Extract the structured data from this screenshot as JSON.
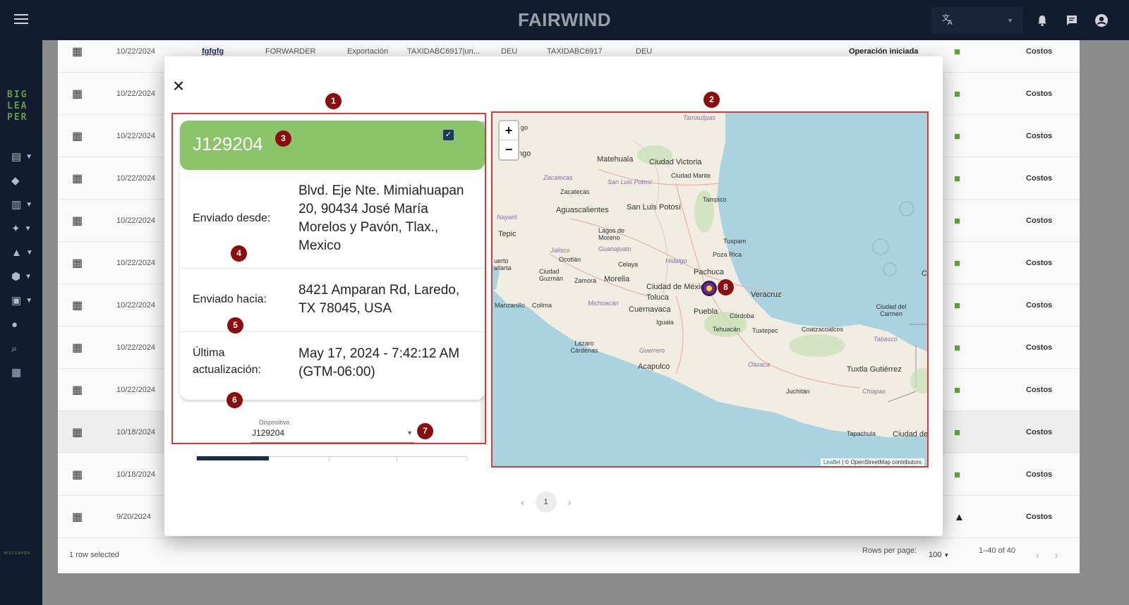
{
  "app": {
    "brand": "FAIRWIND",
    "logo_text": "BIG LEA PER",
    "sidebar_footer": "BIGLEAPER"
  },
  "topbar": {
    "menu_icon": "menu-icon",
    "translate_icon": "translate-icon",
    "notifications_icon": "bell-icon",
    "chat_icon": "chat-icon",
    "account_icon": "account-icon"
  },
  "table": {
    "first_row": {
      "date": "10/22/2024",
      "id": "fgfgfg",
      "role": "FORWARDER",
      "type": "Exportación",
      "taxid": "TAXIDABC6917|un...",
      "country": "DEU",
      "taxid2": "TAXIDABC6917",
      "country2": "DEU",
      "status": "Operación iniciada",
      "action": "Costos"
    },
    "dates": [
      "10/22/2024",
      "10/22/2024",
      "10/22/2024",
      "10/22/2024",
      "10/22/2024",
      "10/22/2024",
      "10/22/2024",
      "10/22/2024",
      "10/22/2024",
      "10/18/2024",
      "10/18/2024",
      "9/20/2024"
    ],
    "action_label": "Costos",
    "footer": {
      "selected": "1 row selected",
      "rows_per_page_label": "Rows per page:",
      "rows_per_page": "100",
      "range": "1–40 of 40"
    }
  },
  "modal": {
    "device_id": "J129204",
    "sent_from_label": "Enviado desde:",
    "sent_from_value": "Blvd. Eje Nte. Mimiahuapan 20, 90434 José María Morelos y Pavón, Tlax., Mexico",
    "sent_to_label": "Enviado hacia:",
    "sent_to_value": "8421 Amparan Rd, Laredo, TX 78045, USA",
    "updated_label": "Última actualización:",
    "updated_value": "May 17, 2024 - 7:42:12 AM (GTM-06:00)",
    "device_select_label": "Dispositivo",
    "device_select_value": "J129204",
    "pagination_current": "1"
  },
  "map": {
    "zoom_in": "+",
    "zoom_out": "−",
    "attribution_leaflet": "Leaflet",
    "attribution_osm": "© OpenStreetMap contributors",
    "places": {
      "tamaulipas": "Tamaulipas",
      "matehuala": "Matehuala",
      "ciudad_victoria": "Ciudad Victoria",
      "ciudad_mante": "Ciudad Mante",
      "zacatecas_state": "Zacatecas",
      "zacatecas": "Zacatecas",
      "slp_state": "San Luis Potosí",
      "slp": "San Luis Potosí",
      "aguascalientes": "Aguascalientes",
      "tampico": "Tampico",
      "nayarit": "Nayarit",
      "tepic": "Tepic",
      "lagos": "Lagos de Moreno",
      "guanajuato": "Guanajuato",
      "tuxpam": "Tuxpam",
      "poza_rica": "Poza Rica",
      "jalisco": "Jalisco",
      "ocotlan": "Ocotlán",
      "celaya": "Celaya",
      "hidalgo": "Hidalgo",
      "pachuca": "Pachuca",
      "ciudad_guzman": "Ciudad Guzmán",
      "zamora": "Zamora",
      "morelia": "Morelia",
      "ciudad_mexico": "Ciudad de México",
      "veracruz": "Veracruz",
      "colima": "Colima",
      "michoacan": "Michoacán",
      "toluca": "Toluca",
      "cuernavaca": "Cuernavaca",
      "puebla": "Puebla",
      "iguala": "Iguala",
      "cordoba": "Córdoba",
      "ciudad_carmen": "Ciudad del Carmen",
      "tehuacan": "Tehuacán",
      "tuxtepec": "Tuxtepec",
      "coatzacoalcos": "Coatzacoalcos",
      "lazaro": "Lázaro Cárdenas",
      "tabasco": "Tabasco",
      "guerrero": "Guerrero",
      "oaxaca": "Oaxaca",
      "acapulco": "Acapulco",
      "tuxtla": "Tuxtla Gutiérrez",
      "juchitan": "Juchitán",
      "chiapas": "Chiapas",
      "tapachula": "Tapachula",
      "ciudad_de": "Ciudad de",
      "manzanillo": "Manzanillo",
      "puerto_vallarta": "uerto allarta",
      "car": "Car",
      "go": "go",
      "ngo": "ngo"
    }
  },
  "annotations": [
    "1",
    "2",
    "3",
    "4",
    "5",
    "6",
    "7",
    "8"
  ],
  "colors": {
    "topbar": "#111c2e",
    "device_header": "#8bc46a",
    "highlight_border": "#d63a3a",
    "badge": "#8b0d0d",
    "truck": "#5aa832"
  }
}
